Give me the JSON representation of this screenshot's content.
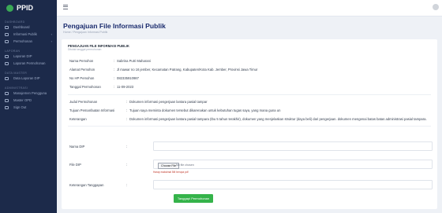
{
  "sidebar": {
    "brand": "PPID",
    "sections": [
      {
        "title": "Dashboard",
        "items": [
          {
            "label": "Dashboard",
            "chevron": false
          }
        ]
      },
      {
        "title": "",
        "items": [
          {
            "label": "Informasi Publik",
            "chevron": true
          },
          {
            "label": "Permohonan",
            "chevron": true
          }
        ]
      },
      {
        "title": "Laporan",
        "items": [
          {
            "label": "Laporan DIP",
            "chevron": false
          },
          {
            "label": "Laporan Permohonan",
            "chevron": false
          }
        ]
      },
      {
        "title": "Data Master",
        "items": [
          {
            "label": "Data Laporan DIP",
            "chevron": false
          }
        ]
      },
      {
        "title": "Administrasi",
        "items": [
          {
            "label": "Manajemen Pengguna",
            "chevron": false
          },
          {
            "label": "Master OPD",
            "chevron": false
          },
          {
            "label": "Sign Out",
            "chevron": false
          }
        ]
      }
    ]
  },
  "header": {
    "title": "Pengajuan File Informasi Publik",
    "breadcrumb": "Home / Pengajuan Informasi Publik"
  },
  "card": {
    "title": "PENGAJUAN FILE INFORMASI PUBLIK",
    "subtitle": "Ditolak tanggal permohonan",
    "sep": ":",
    "info_rows": [
      {
        "label": "Nama Pemohon",
        "value": "Sabrina Putri Maharani"
      },
      {
        "label": "Alamat Pemohon",
        "value": "Jl mawar no 16 jember, Kecamatan Patrang, Kabupaten/Kota Kab. Jember, Provinsi Jawa Timur"
      },
      {
        "label": "No HP Pemohon",
        "value": "082335910987"
      },
      {
        "label": "Tanggal Permohonan",
        "value": "11-09-2023"
      }
    ],
    "detail_rows": [
      {
        "label": "Judul Permohonan",
        "value": "Dokumen informasi pengerjaan lantara pasial tampar"
      },
      {
        "label": "Tujuan Pemanfaatan Informasi",
        "value": "Tujuan saya meminta dokumen tersebut dikarenakan untuk kebutuhan tugas saya, yang mana guna un"
      },
      {
        "label": "Keterangan",
        "value": "Dokumen informasi pengerjaan lantara pasial tampara (Ibu 5 tahun terakhir), dokumen yang menjelaskan struktur (daya beli) dari pengerjaan. dokumen mengenai batas batas administrasi pasial tampara."
      }
    ],
    "form": {
      "nama_dip_label": "Nama DIP",
      "file_dip_label": "File DIP",
      "choose_file": "Choose File",
      "no_file": "No file chosen",
      "file_help": "Harap maksimal 5M berupa pdf",
      "keterangan_label": "Keterangan Tanggapan",
      "submit": "Tanggapi Permohonan"
    }
  },
  "colors": {
    "sidebar_bg": "#1c2a4a",
    "accent_green": "#35b34a",
    "title_blue": "#1a2b6d"
  }
}
